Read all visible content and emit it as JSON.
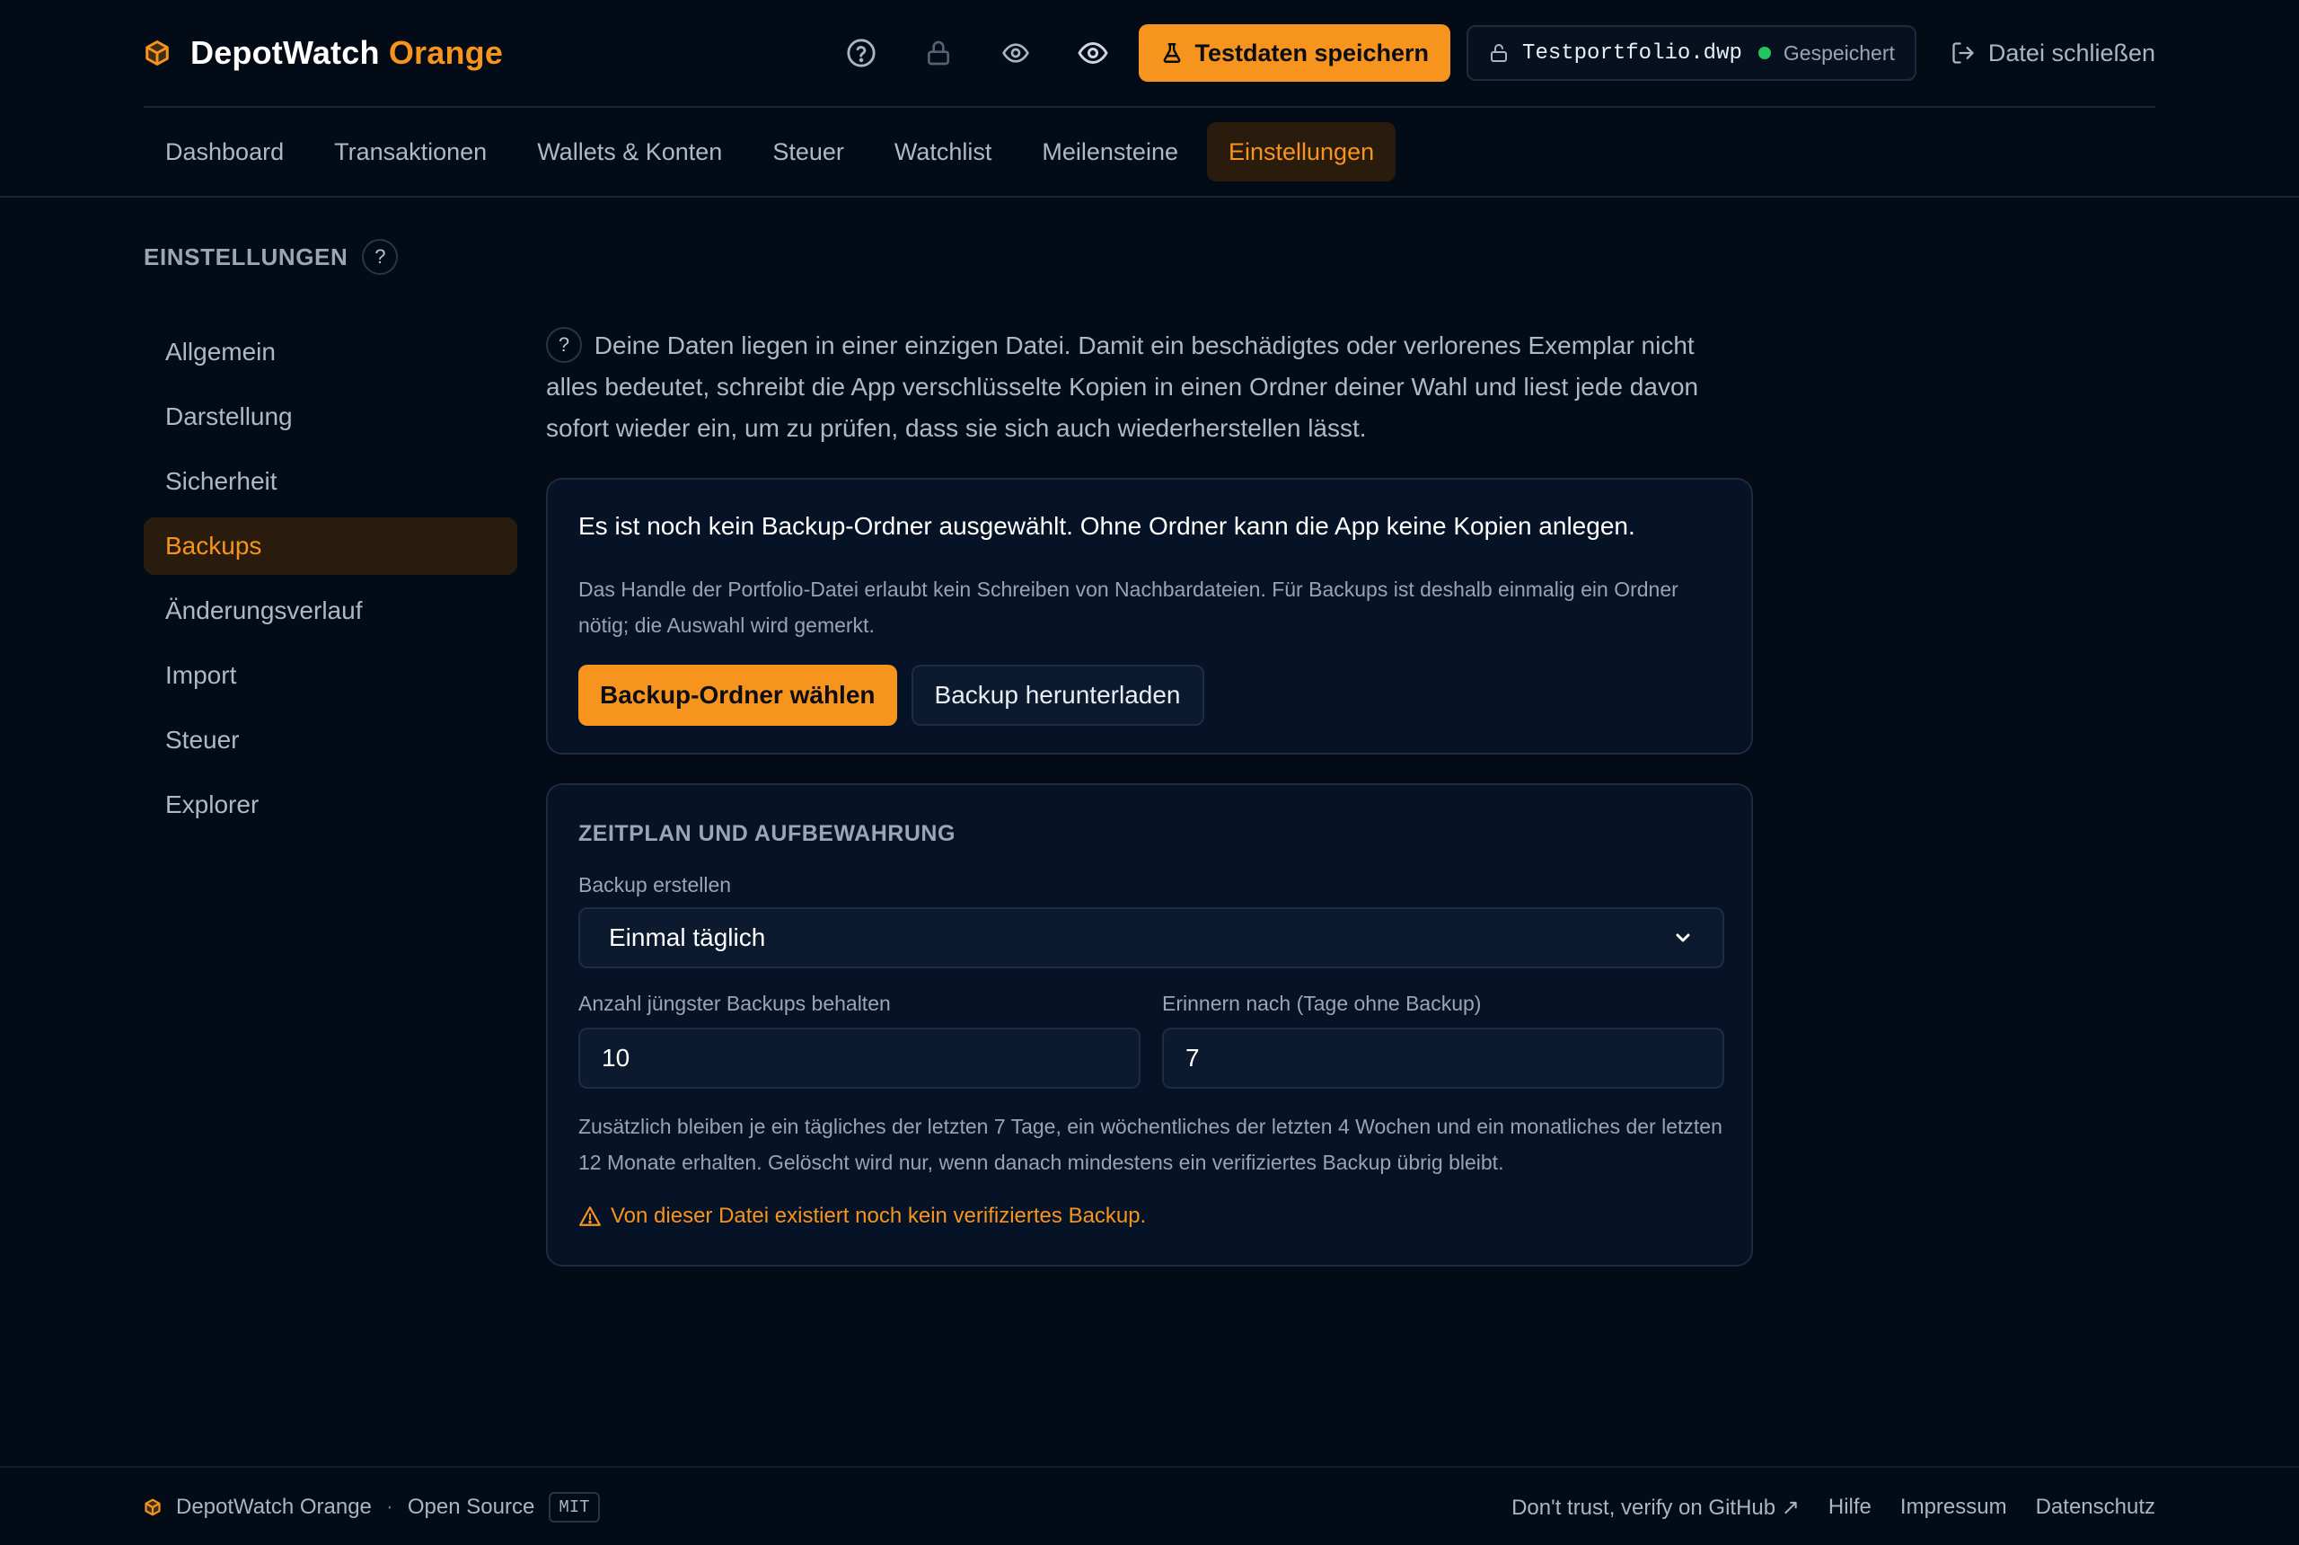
{
  "app": {
    "name": "DepotWatch",
    "name_accent": "Orange",
    "accent_color": "#f7941d"
  },
  "header": {
    "test_button_label": "Testdaten speichern",
    "file_name": "Testportfolio.dwp",
    "file_status": "Gespeichert",
    "status_color": "#22c55e",
    "close_label": "Datei schließen",
    "icons": [
      "help-circle-icon",
      "lock-icon",
      "eye-icon",
      "eye-icon",
      "flask-icon",
      "lock-open-icon",
      "logout-icon"
    ]
  },
  "nav": {
    "tabs": [
      {
        "label": "Dashboard"
      },
      {
        "label": "Transaktionen"
      },
      {
        "label": "Wallets & Konten"
      },
      {
        "label": "Steuer"
      },
      {
        "label": "Watchlist"
      },
      {
        "label": "Meilensteine"
      },
      {
        "label": "Einstellungen",
        "active": true
      }
    ]
  },
  "settings": {
    "title": "EINSTELLUNGEN",
    "help": "?",
    "menu": [
      {
        "label": "Allgemein"
      },
      {
        "label": "Darstellung"
      },
      {
        "label": "Sicherheit"
      },
      {
        "label": "Backups",
        "active": true
      },
      {
        "label": "Änderungsverlauf"
      },
      {
        "label": "Import"
      },
      {
        "label": "Steuer"
      },
      {
        "label": "Explorer"
      }
    ]
  },
  "backups": {
    "intro_help": "?",
    "intro": "Deine Daten liegen in einer einzigen Datei. Damit ein beschädigtes oder verlorenes Exemplar nicht alles bedeutet, schreibt die App verschlüsselte Kopien in einen Ordner deiner Wahl und liest jede davon sofort wieder ein, um zu prüfen, dass sie sich auch wiederherstellen lässt.",
    "folder_card": {
      "headline": "Es ist noch kein Backup-Ordner ausgewählt. Ohne Ordner kann die App keine Kopien anlegen.",
      "sub": "Das Handle der Portfolio-Datei erlaubt kein Schreiben von Nachbardateien. Für Backups ist deshalb einmalig ein Ordner nötig; die Auswahl wird gemerkt.",
      "choose_label": "Backup-Ordner wählen",
      "download_label": "Backup herunterladen"
    },
    "schedule_card": {
      "heading": "ZEITPLAN UND AUFBEWAHRUNG",
      "frequency_label": "Backup erstellen",
      "frequency_value": "Einmal täglich",
      "keep_label": "Anzahl jüngster Backups behalten",
      "keep_value": "10",
      "remind_label": "Erinnern nach (Tage ohne Backup)",
      "remind_value": "7",
      "note": "Zusätzlich bleiben je ein tägliches der letzten 7 Tage, ein wöchentliches der letzten 4 Wochen und ein monatliches der letzten 12 Monate erhalten. Gelöscht wird nur, wenn danach mindestens ein verifiziertes Backup übrig bleibt.",
      "warning": "Von dieser Datei existiert noch kein verifiziertes Backup."
    }
  },
  "footer": {
    "brand": "DepotWatch Orange",
    "sep": "·",
    "open_source": "Open Source",
    "license": "MIT",
    "links": [
      {
        "label": "Don't trust, verify on GitHub ↗"
      },
      {
        "label": "Hilfe"
      },
      {
        "label": "Impressum"
      },
      {
        "label": "Datenschutz"
      }
    ]
  }
}
